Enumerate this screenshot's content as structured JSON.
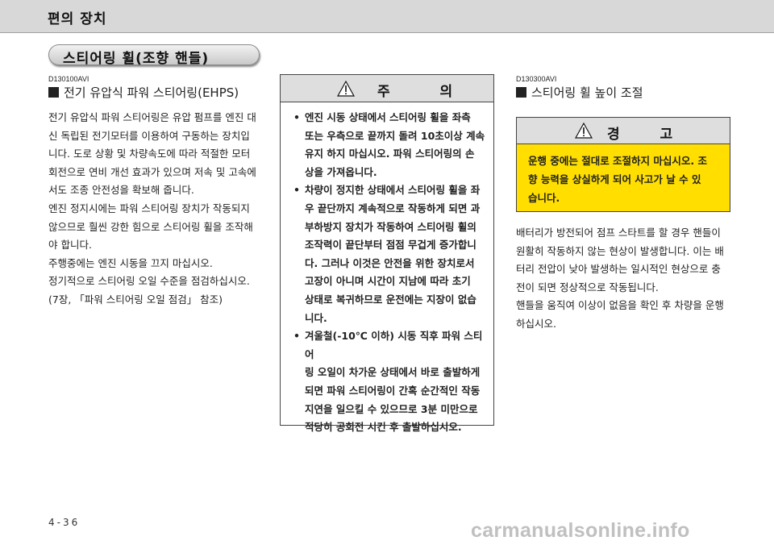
{
  "header": {
    "chapter_title": "편의 장치"
  },
  "section": {
    "title": "스티어링 휠(조향 핸들)"
  },
  "left": {
    "code": "D130100AVI",
    "heading": "전기 유압식 파워 스티어링(EHPS)",
    "paragraphs": [
      "전기 유압식 파워 스티어링은 유압 펌프를 엔진 대",
      "신 독립된 전기모터를 이용하여 구동하는 장치입",
      "니다. 도로 상황 및 차량속도에 따라 적절한 모터",
      "회전으로 연비 개선 효과가 있으며 저속 및 고속에",
      "서도 조종 안전성을 확보해 줍니다.",
      "엔진 정지시에는 파워 스티어링 장치가 작동되지",
      "않으므로 훨씬 강한 힘으로 스티어링 휠을 조작해",
      "야 합니다.",
      "주행중에는 엔진 시동을 끄지 마십시오.",
      "정기적으로 스티어링 오일 수준을 점검하십시오.",
      "(7장, 「파워 스티어링 오일 점검」 참조)"
    ]
  },
  "caution": {
    "title": "주 의",
    "icon": "warning-triangle-icon",
    "bullet": "•",
    "items": [
      [
        "엔진 시동 상태에서 스티어링 휠을 좌측",
        "또는 우측으로 끝까지 돌려 10초이상 계속",
        "유지 하지 마십시오. 파워 스티어링의 손",
        "상을 가져옵니다."
      ],
      [
        "차량이 정지한 상태에서 스티어링 휠을 좌",
        "우 끝단까지 계속적으로 작동하게 되면 과",
        "부하방지 장치가 작동하여 스티어링 휠의",
        "조작력이 끝단부터 점점 무겁게 증가합니",
        "다. 그러나 이것은 안전을 위한 장치로서",
        "고장이 아니며 시간이 지남에 따라 초기",
        "상태로 복귀하므로 운전에는 지장이 없습",
        "니다."
      ],
      [
        "겨울철(-10℃ 이하) 시동 직후 파워 스티어",
        "링 오일이 차가운 상태에서 바로 출발하게",
        "되면 파워 스티어링이 간혹 순간적인 작동",
        "지연을 일으킬 수 있으므로 3분 미만으로",
        "적당히 공회전 시킨 후 출발하십시오."
      ]
    ]
  },
  "right": {
    "code": "D130300AVI",
    "heading": "스티어링 휠 높이 조절",
    "warning": {
      "title": "경 고",
      "icon": "warning-triangle-icon",
      "lines": [
        "운행 중에는 절대로 조절하지 마십시오. 조",
        "향 능력을 상실하게 되어 사고가 날 수 있",
        "습니다."
      ]
    },
    "paragraphs": [
      "배터리가 방전되어 점프 스타트를 할 경우 핸들이",
      "원활히 작동하지 않는 현상이 발생합니다. 이는 배",
      "터리 전압이 낮아 발생하는 일시적인 현상으로 충",
      "전이 되면 정상적으로 작동됩니다.",
      "핸들을 움직여 이상이 없음을 확인 후 차량을 운행",
      "하십시오."
    ]
  },
  "footer": {
    "page_number": "4-36",
    "watermark": "carmanualsonline.info"
  },
  "colors": {
    "header_band": "#d8d8d8",
    "warning_fill": "#ffde00",
    "box_head": "#dedede"
  }
}
